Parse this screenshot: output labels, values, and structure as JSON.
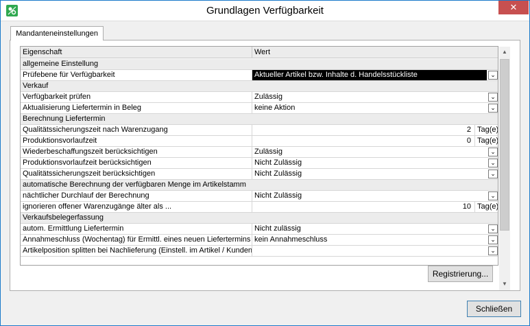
{
  "window": {
    "title": "Grundlagen Verfügbarkeit",
    "close_symbol": "✕"
  },
  "tabs": [
    {
      "label": "Mandanteneinstellungen"
    }
  ],
  "grid": {
    "columns": {
      "property": "Eigenschaft",
      "value": "Wert"
    },
    "rows": [
      {
        "type": "group",
        "label": "allgemeine Einstellung"
      },
      {
        "type": "dropdown",
        "label": "Prüfebene für Verfügbarkeit",
        "value": "Aktueller Artikel bzw. Inhalte d. Handelsstückliste",
        "selected": true
      },
      {
        "type": "group",
        "label": "Verkauf"
      },
      {
        "type": "dropdown",
        "label": "Verfügbarkeit prüfen",
        "value": "Zulässig"
      },
      {
        "type": "dropdown",
        "label": "Aktualisierung Liefertermin in Beleg",
        "value": "keine Aktion"
      },
      {
        "type": "group",
        "label": "Berechnung Liefertermin"
      },
      {
        "type": "number",
        "label": "Qualitätssicherungszeit nach Warenzugang",
        "value": "2",
        "unit": "Tag(e)"
      },
      {
        "type": "number",
        "label": "Produktionsvorlaufzeit",
        "value": "0",
        "unit": "Tag(e)"
      },
      {
        "type": "dropdown",
        "label": "Wiederbeschaffungszeit berücksichtigen",
        "value": "Zulässig"
      },
      {
        "type": "dropdown",
        "label": "Produktionsvorlaufzeit berücksichtigen",
        "value": "Nicht Zulässig"
      },
      {
        "type": "dropdown",
        "label": "Qualitätssicherungszeit berücksichtigen",
        "value": "Nicht Zulässig"
      },
      {
        "type": "group",
        "label": "automatische Berechnung der verfügbaren Menge im Artikelstamm"
      },
      {
        "type": "dropdown",
        "label": "nächtlicher Durchlauf der Berechnung",
        "value": "Nicht Zulässig"
      },
      {
        "type": "number",
        "label": "ignorieren offener Warenzugänge älter als ...",
        "value": "10",
        "unit": "Tag(e)"
      },
      {
        "type": "group",
        "label": "Verkaufsbelegerfassung"
      },
      {
        "type": "dropdown",
        "label": "autom. Ermittlung Liefertermin",
        "value": "Nicht zulässig"
      },
      {
        "type": "dropdown",
        "label": "Annahmeschluss (Wochentag) für Ermittl. eines neuen Liefertermins",
        "value": "kein Annahmeschluss"
      },
      {
        "type": "dropdown",
        "label": "Artikelposition splitten bei Nachlieferung (Einstell. im Artikel / Kunden)",
        "value": ""
      }
    ]
  },
  "buttons": {
    "register": "Registrierung...",
    "close": "Schließen"
  },
  "icons": {
    "dropdown": "chevron-down-icon",
    "scroll_up": "scroll-up-icon",
    "scroll_down": "scroll-down-icon"
  },
  "colors": {
    "selection": "#000000",
    "group_bg": "#ececec",
    "close_button": "#c75050",
    "window_border": "#1979ca"
  }
}
